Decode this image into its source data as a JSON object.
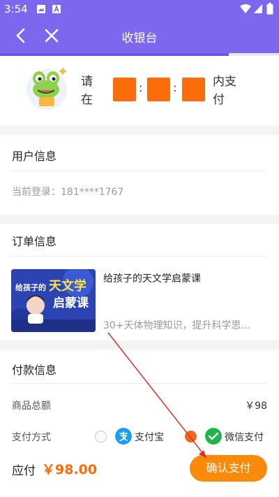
{
  "status_bar": {
    "time": "3:54"
  },
  "nav": {
    "title": "收银台",
    "progress_fraction": 0.82
  },
  "timer": {
    "prompt_left": "请在",
    "prompt_right": "内支付"
  },
  "user_section": {
    "title": "用户信息",
    "login_text": "当前登录：181****1767"
  },
  "order_section": {
    "title": "订单信息",
    "course_title": "给孩子的天文学启蒙课",
    "course_desc": "30+天体物理知识，提升科学思…",
    "thumb_heading_1": "给孩子的",
    "thumb_heading_2": "天文学",
    "thumb_heading_3": "启蒙课"
  },
  "payment_section": {
    "title": "付款信息",
    "total_label": "商品总额",
    "total_value": "￥98",
    "method_label": "支付方式",
    "methods": [
      {
        "name": "支付宝",
        "icon": "alipay-icon",
        "selected": false
      },
      {
        "name": "微信支付",
        "icon": "wechat-icon",
        "selected": true
      }
    ]
  },
  "bottom_bar": {
    "due_label": "应付",
    "due_amount": "￥98.00",
    "confirm_label": "确认支付"
  },
  "colors": {
    "nav": "#7d67ee",
    "accent_orange": "#fb6d0a",
    "button": "#fb8a0b",
    "alipay": "#1a9cf0",
    "wechat": "#21b44a"
  }
}
